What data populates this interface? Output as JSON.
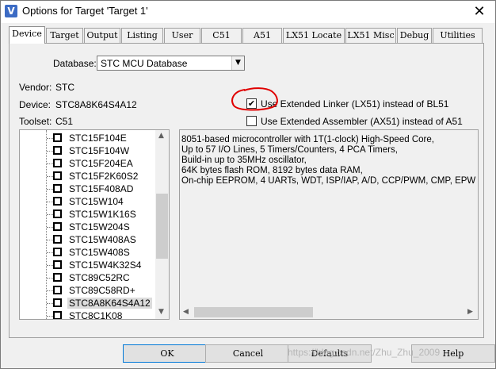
{
  "window": {
    "title": "Options for Target 'Target 1'",
    "icon": "uvision-icon",
    "close_glyph": "✕"
  },
  "tabs": [
    {
      "label": "Device",
      "active": true
    },
    {
      "label": "Target"
    },
    {
      "label": "Output"
    },
    {
      "label": "Listing"
    },
    {
      "label": "User"
    },
    {
      "label": "C51"
    },
    {
      "label": "A51"
    },
    {
      "label": "LX51 Locate"
    },
    {
      "label": "LX51 Misc"
    },
    {
      "label": "Debug"
    },
    {
      "label": "Utilities"
    }
  ],
  "device_tab": {
    "database_label": "Database:",
    "database_value": "STC MCU Database",
    "vendor_label": "Vendor:",
    "vendor_value": "STC",
    "device_label": "Device:",
    "device_value": "STC8A8K64S4A12",
    "toolset_label": "Toolset:",
    "toolset_value": "C51",
    "use_lx51_label": "Use Extended Linker (LX51) instead of BL51",
    "use_lx51_checked": true,
    "use_ax51_label": "Use Extended Assembler (AX51) instead of A51",
    "use_ax51_checked": false
  },
  "device_tree": {
    "items": [
      "STC15F104E",
      "STC15F104W",
      "STC15F204EA",
      "STC15F2K60S2",
      "STC15F408AD",
      "STC15W104",
      "STC15W1K16S",
      "STC15W204S",
      "STC15W408AS",
      "STC15W408S",
      "STC15W4K32S4",
      "STC89C52RC",
      "STC89C58RD+",
      "STC8A8K64S4A12",
      "STC8C1K08"
    ],
    "selected": "STC8A8K64S4A12"
  },
  "description": {
    "lines": [
      "8051-based microcontroller with 1T(1-clock) High-Speed Core,",
      "Up to 57 I/O Lines, 5 Timers/Counters, 4 PCA Timers,",
      "Build-in up to 35MHz oscillator,",
      "64K bytes flash ROM, 8192 bytes data RAM,",
      "On-chip EEPROM, 4 UARTs, WDT, ISP/IAP, A/D, CCP/PWM, CMP, EPW"
    ]
  },
  "buttons": {
    "ok": "OK",
    "cancel": "Cancel",
    "defaults": "Defaults",
    "help": "Help"
  },
  "watermark": "https://blog.csdn.net/Zhu_Zhu_2009",
  "colors": {
    "annotation_circle": "#e00000",
    "focus_border": "#0078d7",
    "selection_bg": "#dcdcdc"
  }
}
